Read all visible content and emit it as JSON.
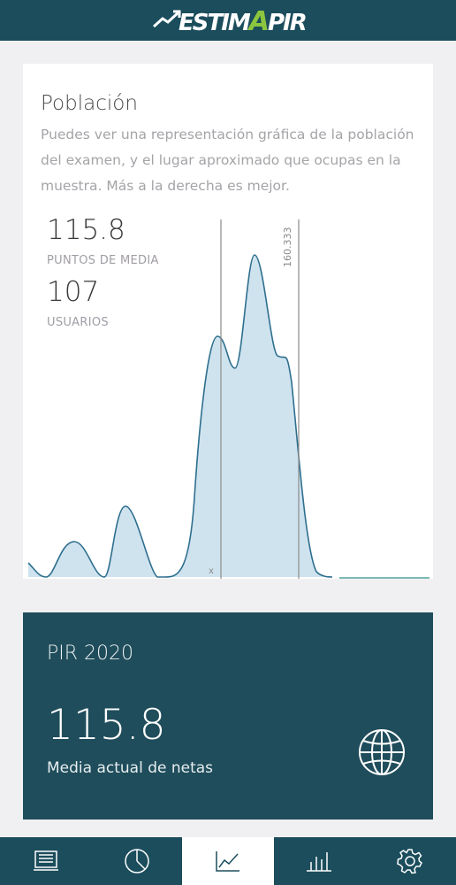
{
  "header": {
    "logo_text_a": "ESTIM",
    "logo_text_b": "A",
    "logo_text_c": "PIR"
  },
  "population": {
    "title": "Población",
    "description": "Puedes ver una representación gráfica de la población del examen, y el lugar aproximado que ocupas en la muestra. Más a la derecha es mejor.",
    "mean_value": "115.8",
    "mean_label": "PUNTOS DE MEDIA",
    "users_value": "107",
    "users_label": "USUARIOS"
  },
  "chart_data": {
    "type": "area",
    "title": "",
    "xlabel": "",
    "ylabel": "",
    "annotations": [
      {
        "type": "vline",
        "label": "",
        "marker": "x",
        "position": "mean"
      },
      {
        "type": "vline",
        "label": "160.333"
      }
    ],
    "grid": false,
    "legend": "none",
    "fill_color": "#cfe3ef",
    "line_color": "#2e6f8e"
  },
  "pir_card": {
    "title": "PIR 2020",
    "value": "115.8",
    "subtitle": "Media actual de netas",
    "icon": "globe-icon"
  },
  "nav": {
    "items": [
      {
        "name": "news-icon",
        "active": false
      },
      {
        "name": "pie-chart-icon",
        "active": false
      },
      {
        "name": "line-chart-icon",
        "active": true
      },
      {
        "name": "bar-chart-icon",
        "active": false
      },
      {
        "name": "gear-icon",
        "active": false
      }
    ]
  },
  "colors": {
    "primary": "#1b4d5c",
    "accent": "#8cc63f",
    "background": "#f0f0f2"
  }
}
